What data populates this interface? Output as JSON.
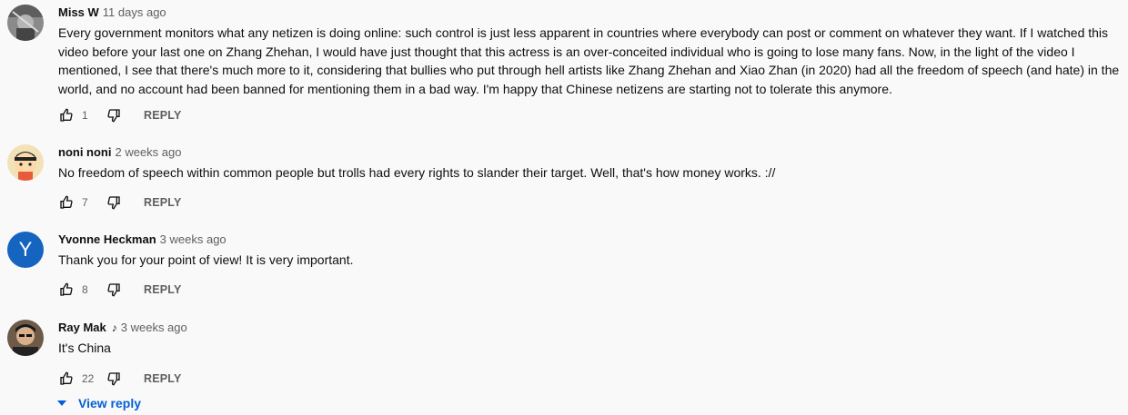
{
  "comments": [
    {
      "author": "Miss W",
      "time": "11 days ago",
      "text": "Every government monitors what any  netizen is doing online: such control is just less apparent in countries where everybody can post or comment on whatever they want. If I watched this video before your last one on Zhang Zhehan, I would have just thought that this actress is an over-conceited individual who is going to lose many fans. Now, in the light of the video I mentioned, I see that there's much more to it,  considering that bullies who put through hell artists like Zhang Zhehan and Xiao Zhan (in 2020) had all the freedom of speech (and hate) in the world, and no account had been banned for mentioning them in a bad way.  I'm happy that Chinese netizens are starting not to tolerate this anymore.",
      "likes": "1",
      "reply_label": "REPLY",
      "avatar_color": "#6b6b6b"
    },
    {
      "author": "noni noni",
      "time": "2 weeks ago",
      "text": "No freedom of speech within common people but trolls had every rights to slander their target. Well, that's how money works. ://",
      "likes": "7",
      "reply_label": "REPLY",
      "avatar_color": "#e8c98a"
    },
    {
      "author": "Yvonne Heckman",
      "time": "3 weeks ago",
      "text": "Thank you for your point of view! It is very important.",
      "likes": "8",
      "reply_label": "REPLY",
      "avatar_letter": "Y",
      "avatar_color": "#1565c0"
    },
    {
      "author": "Ray Mak",
      "music_icon": "music-note-icon",
      "time": "3 weeks ago",
      "text": "It's China",
      "likes": "22",
      "reply_label": "REPLY",
      "avatar_color": "#3a3a3a"
    }
  ],
  "view_reply": "View reply",
  "colors": {
    "link": "#065fd4",
    "secondary": "#606060",
    "background": "#f9f9f9"
  }
}
